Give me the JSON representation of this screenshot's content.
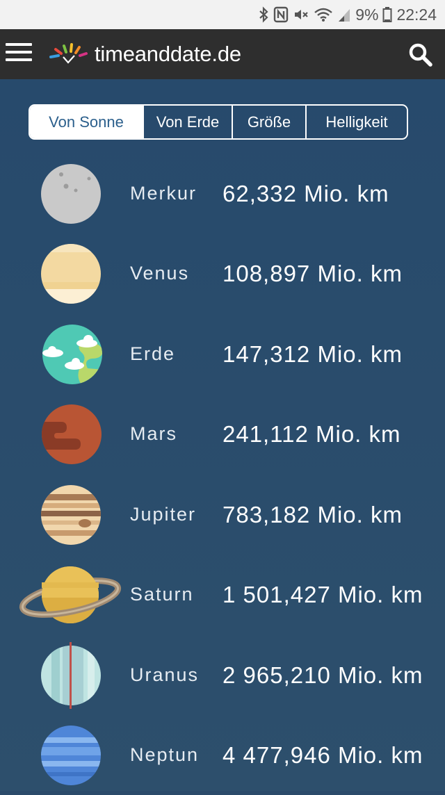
{
  "status_bar": {
    "battery": "9%",
    "time": "22:24",
    "icons": [
      "bluetooth-icon",
      "nfc-icon",
      "mute-icon",
      "wifi-icon",
      "signal-icon",
      "battery-icon"
    ]
  },
  "header": {
    "logo_text": "timeanddate.de",
    "icons": [
      "menu-icon",
      "search-icon"
    ]
  },
  "tabs": [
    {
      "label": "Von Sonne",
      "active": true
    },
    {
      "label": "Von Erde",
      "active": false
    },
    {
      "label": "Größe",
      "active": false
    },
    {
      "label": "Helligkeit",
      "active": false
    }
  ],
  "planets": [
    {
      "name": "Merkur",
      "distance": "62,332 Mio. km"
    },
    {
      "name": "Venus",
      "distance": "108,897 Mio. km"
    },
    {
      "name": "Erde",
      "distance": "147,312 Mio. km"
    },
    {
      "name": "Mars",
      "distance": "241,112 Mio. km"
    },
    {
      "name": "Jupiter",
      "distance": "783,182 Mio. km"
    },
    {
      "name": "Saturn",
      "distance": "1 501,427 Mio. km"
    },
    {
      "name": "Uranus",
      "distance": "2 965,210 Mio. km"
    },
    {
      "name": "Neptun",
      "distance": "4 477,946 Mio. km"
    }
  ],
  "colors": {
    "header_bg": "#2e2e2e",
    "content_bg": "#274a6c",
    "active_tab_text": "#2b5f8c"
  }
}
